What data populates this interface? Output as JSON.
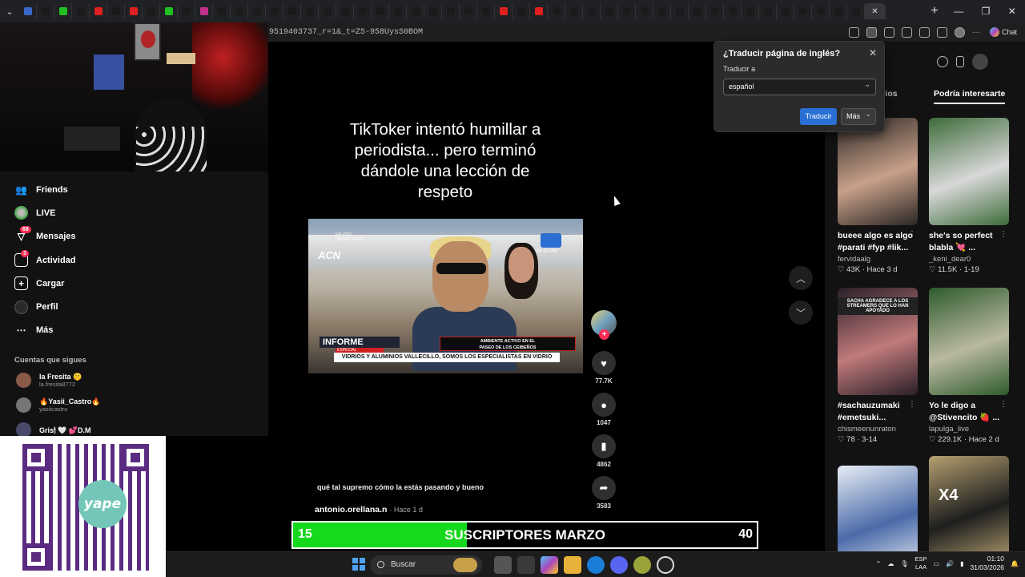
{
  "browser": {
    "url": "9519403737_r=1&_t=ZS-958UysS0BOM",
    "chat_label": "Chat",
    "tab_colors": [
      "#3a68c8",
      "#1a1a1a",
      "#20c020",
      "#1a1a1a",
      "#e02020",
      "#1a1a1a",
      "#e02020",
      "#1a1a1a",
      "#20c020",
      "#1a1a1a",
      "#c0308a",
      "#1a1a1a",
      "#1a1a1a",
      "#1a1a1a",
      "#1a1a1a",
      "#1a1a1a",
      "#1a1a1a",
      "#1a1a1a",
      "#1a1a1a",
      "#1a1a1a",
      "#1a1a1a",
      "#1a1a1a",
      "#1a1a1a",
      "#1a1a1a",
      "#1a1a1a",
      "#1a1a1a",
      "#1a1a1a",
      "#e02020",
      "#1a1a1a",
      "#e02020",
      "#1a1a1a",
      "#1a1a1a",
      "#1a1a1a",
      "#1a1a1a",
      "#1a1a1a",
      "#1a1a1a",
      "#1a1a1a",
      "#1a1a1a",
      "#1a1a1a",
      "#1a1a1a",
      "#1a1a1a",
      "#1a1a1a",
      "#1a1a1a",
      "#1a1a1a",
      "#1a1a1a",
      "#1a1a1a",
      "#1a1a1a",
      "#1a1a1a"
    ]
  },
  "sidebar": {
    "items": [
      {
        "label": "Friends",
        "icon": "friends-icon"
      },
      {
        "label": "LIVE",
        "icon": "live-icon"
      },
      {
        "label": "Mensajes",
        "icon": "messages-icon",
        "badge": "68"
      },
      {
        "label": "Actividad",
        "icon": "activity-icon",
        "badge": "3"
      },
      {
        "label": "Cargar",
        "icon": "upload-icon"
      },
      {
        "label": "Perfil",
        "icon": "profile-icon"
      },
      {
        "label": "Más",
        "icon": "more-icon"
      }
    ],
    "following_title": "Cuentas que sigues",
    "following": [
      {
        "name": "la Fresita 🤫",
        "handle": "la.fresita8772"
      },
      {
        "name": "🔥Yasii_Castro🔥",
        "handle": "yasiicastro"
      },
      {
        "name": "Gris🕯 🤍 💕D.M",
        "handle": ""
      }
    ]
  },
  "video": {
    "title": "TikToker intentó humillar a periodista... pero terminó dándole una lección de respeto",
    "thumb": {
      "brand": "ACN",
      "live_text": "EN VIVO\nUNIDAD MÓVIL",
      "time": "04:33 PM",
      "lower_title": "INFORME",
      "lower_sub": "ESPECIAL",
      "ambient": "AMBIENTE ACTIVO EN EL\nPASEO DE LOS CEIBEÑOS",
      "ticker": "VIDRIOS Y ALUMINIOS VALLECILLO,  SOMOS LOS ESPECIALISTAS EN VIDRIO"
    },
    "caption": "qué tal supremo cómo la estás pasando y bueno",
    "author": "antonio.orellana.n",
    "age": "· Hace 1 d",
    "likes": "77.7K",
    "comments": "1047",
    "saves": "4862",
    "shares": "3583"
  },
  "right_panel": {
    "tab_comments": "tarios",
    "tab_suggested": "Podría interesarte",
    "cards": [
      {
        "caption": "bueee algo es algo #parati #fyp #lik...",
        "user": "fervidaalg",
        "stats": "♡ 43K · Hace 3 d",
        "colors": [
          "#2a2623",
          "#c8a08a"
        ]
      },
      {
        "caption": "she's so perfect blabla 💘 ...",
        "user": "_keni_dear0",
        "stats": "♡ 11.5K · 1-19",
        "colors": [
          "#3d6b3a",
          "#d8d8d8"
        ]
      },
      {
        "caption": "#sachauzumaki #emetsuki...",
        "user": "chismeenunraton",
        "stats": "♡ 78 · 3-14",
        "colors": [
          "#2a1f28",
          "#c07a7a"
        ]
      },
      {
        "caption": "Yo le digo a @Stivencito 🍓 ...",
        "user": "lapulga_live",
        "stats": "♡ 229.1K · Hace 2 d",
        "colors": [
          "#2e5a2e",
          "#b9b9a0"
        ]
      },
      {
        "caption": "",
        "user": "",
        "stats": "",
        "colors": [
          "#e8eef5",
          "#4b6aa8"
        ]
      },
      {
        "caption": "",
        "user": "",
        "stats": "",
        "colors": [
          "#b5a070",
          "#1e1e1e"
        ]
      }
    ],
    "card_texts": [
      "SACHA AGRADECE A LOS STREAMERS QUE LO HAN APOYADO",
      "X4"
    ]
  },
  "translate": {
    "title": "¿Traducir página de inglés?",
    "label": "Traducir a",
    "language": "español",
    "translate_button": "Traducir",
    "more_button": "Más"
  },
  "subs": {
    "current": "15",
    "label": "SUSCRIPTORES MARZO",
    "goal": "40",
    "progress": 0.375
  },
  "taskbar": {
    "search": "Buscar",
    "lang_top": "ESP",
    "lang_bottom": "LAA",
    "time": "01:10",
    "date": "31/03/2026"
  }
}
